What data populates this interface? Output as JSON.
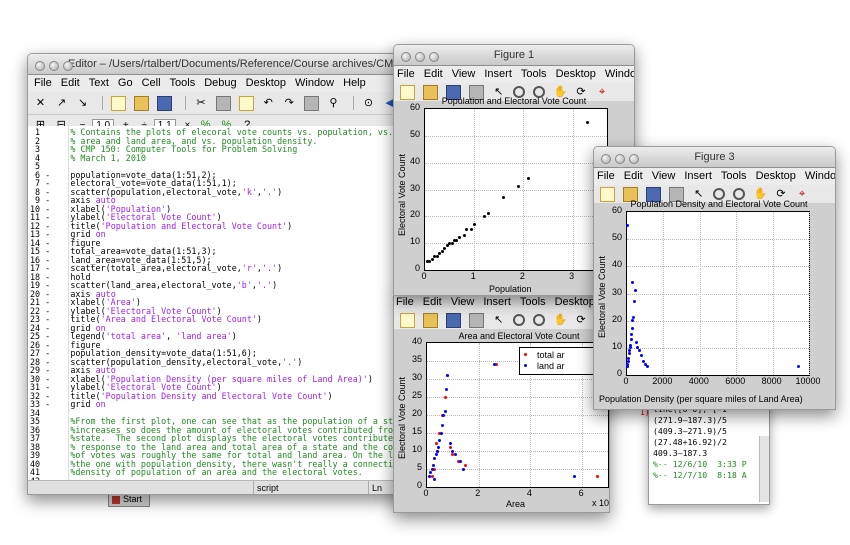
{
  "editor": {
    "title": "Editor – /Users/rtalbert/Documents/Reference/Course archives/CMP150/Feb",
    "menu": [
      "File",
      "Edit",
      "Text",
      "Go",
      "Cell",
      "Tools",
      "Debug",
      "Desktop",
      "Window",
      "Help"
    ],
    "cell_toolbar": {
      "minus": "−",
      "val1": "1.0",
      "plus": "+",
      "div": "÷",
      "val2": "1.1",
      "x": "×"
    },
    "lines": [
      {
        "n": "1",
        "d": "",
        "t": "% Contains the plots of elecoral vote counts vs. population, vs. total",
        "c": "c"
      },
      {
        "n": "2",
        "d": "",
        "t": "% area and land area, and vs. population density.",
        "c": "c"
      },
      {
        "n": "3",
        "d": "",
        "t": "% CMP 150: Computer Tools for Problem Solving",
        "c": "c"
      },
      {
        "n": "4",
        "d": "",
        "t": "% March 1, 2010",
        "c": "c"
      },
      {
        "n": "5",
        "d": "",
        "t": "",
        "c": ""
      },
      {
        "n": "6",
        "d": "-",
        "t": "population=vote_data(1:51,2);",
        "c": ""
      },
      {
        "n": "7",
        "d": "-",
        "t": "electoral_vote=vote_data(1:51,1);",
        "c": ""
      },
      {
        "n": "8",
        "d": "-",
        "t": "scatter(population,electoral_vote,'k','.')",
        "c": ""
      },
      {
        "n": "9",
        "d": "-",
        "t": "axis auto",
        "c": ""
      },
      {
        "n": "10",
        "d": "-",
        "t": "xlabel('Population')",
        "c": ""
      },
      {
        "n": "11",
        "d": "-",
        "t": "ylabel('Electoral Vote Count')",
        "c": ""
      },
      {
        "n": "12",
        "d": "-",
        "t": "title('Population and Electoral Vote Count')",
        "c": ""
      },
      {
        "n": "13",
        "d": "-",
        "t": "grid on",
        "c": ""
      },
      {
        "n": "14",
        "d": "-",
        "t": "figure",
        "c": ""
      },
      {
        "n": "15",
        "d": "-",
        "t": "total_area=vote_data(1:51,3);",
        "c": ""
      },
      {
        "n": "16",
        "d": "-",
        "t": "land_area=vote_data(1:51,5);",
        "c": ""
      },
      {
        "n": "17",
        "d": "-",
        "t": "scatter(total_area,electoral_vote,'r','.')",
        "c": ""
      },
      {
        "n": "18",
        "d": "-",
        "t": "hold",
        "c": ""
      },
      {
        "n": "19",
        "d": "-",
        "t": "scatter(land_area,electoral_vote,'b','.')",
        "c": ""
      },
      {
        "n": "20",
        "d": "-",
        "t": "axis auto",
        "c": ""
      },
      {
        "n": "21",
        "d": "-",
        "t": "xlabel('Area')",
        "c": ""
      },
      {
        "n": "22",
        "d": "-",
        "t": "ylabel('Electoral Vote Count')",
        "c": ""
      },
      {
        "n": "23",
        "d": "-",
        "t": "title('Area and Electoral Vote Count')",
        "c": ""
      },
      {
        "n": "24",
        "d": "-",
        "t": "grid on",
        "c": ""
      },
      {
        "n": "25",
        "d": "-",
        "t": "legend('total area', 'land area')",
        "c": ""
      },
      {
        "n": "26",
        "d": "-",
        "t": "figure",
        "c": ""
      },
      {
        "n": "27",
        "d": "-",
        "t": "population_density=vote_data(1:51,6);",
        "c": ""
      },
      {
        "n": "28",
        "d": "-",
        "t": "scatter(population_density,electoral_vote,'.')",
        "c": ""
      },
      {
        "n": "29",
        "d": "-",
        "t": "axis auto",
        "c": ""
      },
      {
        "n": "30",
        "d": "-",
        "t": "xlabel('Population Density (per square miles of Land Area)')",
        "c": ""
      },
      {
        "n": "31",
        "d": "-",
        "t": "ylabel('Electoral Vote Count')",
        "c": ""
      },
      {
        "n": "32",
        "d": "-",
        "t": "title('Population Density and Electoral Vote Count')",
        "c": ""
      },
      {
        "n": "33",
        "d": "-",
        "t": "grid on",
        "c": ""
      },
      {
        "n": "34",
        "d": "",
        "t": "",
        "c": ""
      },
      {
        "n": "35",
        "d": "",
        "t": "%From the first plot, one can see that as the population of a state",
        "c": "c"
      },
      {
        "n": "36",
        "d": "",
        "t": "%increases so does the amount of electoral votes contributed from that",
        "c": "c"
      },
      {
        "n": "37",
        "d": "",
        "t": "%state.  The second plot displays the electoral votes contributed in",
        "c": "c"
      },
      {
        "n": "38",
        "d": "",
        "t": "% response to the land area and total area of a state and the contributi",
        "c": "c"
      },
      {
        "n": "39",
        "d": "",
        "t": "%of votes was roughly the same for total and land area. On the last plot,",
        "c": "c"
      },
      {
        "n": "40",
        "d": "",
        "t": "%the one with population density, there wasn't really a connection to the",
        "c": "c"
      },
      {
        "n": "41",
        "d": "",
        "t": "%density of population of an area and the electoral votes.",
        "c": "c"
      },
      {
        "n": "42",
        "d": "",
        "t": "",
        "c": ""
      },
      {
        "n": "43",
        "d": "",
        "t": "",
        "c": ""
      }
    ],
    "status": {
      "mode": "script",
      "ln": "Ln",
      "col": "3"
    }
  },
  "start_button": "Start",
  "figure1": {
    "title": "Figure 1",
    "menu": [
      "File",
      "Edit",
      "View",
      "Insert",
      "Tools",
      "Desktop",
      "Window",
      "Help"
    ],
    "plot_title": "Population and Electoral Vote Count",
    "xlabel": "Population",
    "ylabel": "Electoral Vote Count",
    "yticks": [
      "0",
      "10",
      "20",
      "30",
      "40",
      "50",
      "60"
    ],
    "xticks": [
      "0",
      "1",
      "2",
      "3"
    ]
  },
  "figure2": {
    "menu": [
      "File",
      "Edit",
      "View",
      "Insert",
      "Tools",
      "Desktop",
      "Window"
    ],
    "plot_title": "Area and Electoral Vote Count",
    "xlabel": "Area",
    "ylabel": "Electoral Vote Count",
    "yticks": [
      "0",
      "5",
      "10",
      "15",
      "20",
      "25",
      "30",
      "35",
      "40"
    ],
    "xticks": [
      "0",
      "2",
      "4",
      "6"
    ],
    "xexp": "x 10",
    "xexp_sup": "6",
    "legend": [
      "total ar",
      "land ar"
    ]
  },
  "figure3": {
    "title": "Figure 3",
    "menu": [
      "File",
      "Edit",
      "View",
      "Insert",
      "Tools",
      "Desktop",
      "Window",
      "Help"
    ],
    "plot_title": "Population Density and Electoral Vote Count",
    "xlabel": "Population Density (per square miles of Land Area)",
    "ylabel": "Electoral Vote Count",
    "yticks": [
      "0",
      "10",
      "20",
      "30",
      "40",
      "50",
      "60"
    ],
    "xticks": [
      "0",
      "2000",
      "4000",
      "6000",
      "8000",
      "10000"
    ]
  },
  "history": {
    "lines": [
      "line([0 0], [-1",
      "(271.9–187.3)/5",
      "(409.3–271.9)/5",
      "(27.48+16.92)/2",
      "409.3–187.3",
      "%-- 12/6/10  3:33 P",
      "%-- 12/7/10  8:18 A"
    ],
    "label": "1)"
  },
  "colors": {
    "series_total": "#ff0000",
    "series_land": "#0000ff",
    "pop": "#000000",
    "comment": "#228b22",
    "string": "#a020f0"
  },
  "chart_data": [
    {
      "type": "scatter",
      "title": "Population and Electoral Vote Count",
      "xlabel": "Population",
      "ylabel": "Electoral Vote Count",
      "xlim": [
        0,
        3.7
      ],
      "ylim": [
        0,
        60
      ],
      "series": [
        {
          "values": [
            [
              0.05,
              3
            ],
            [
              0.1,
              3
            ],
            [
              0.15,
              4
            ],
            [
              0.2,
              5
            ],
            [
              0.25,
              5
            ],
            [
              0.3,
              6
            ],
            [
              0.35,
              7
            ],
            [
              0.4,
              8
            ],
            [
              0.45,
              9
            ],
            [
              0.5,
              10
            ],
            [
              0.55,
              10
            ],
            [
              0.6,
              11
            ],
            [
              0.65,
              11
            ],
            [
              0.7,
              12
            ],
            [
              0.8,
              13
            ],
            [
              0.85,
              15
            ],
            [
              0.95,
              15
            ],
            [
              1.0,
              17
            ],
            [
              1.2,
              20
            ],
            [
              1.3,
              21
            ],
            [
              1.6,
              27
            ],
            [
              1.9,
              31
            ],
            [
              2.1,
              34
            ],
            [
              3.3,
              55
            ]
          ]
        }
      ]
    },
    {
      "type": "scatter",
      "title": "Area and Electoral Vote Count",
      "xlabel": "Area",
      "ylabel": "Electoral Vote Count",
      "xlim": [
        0,
        7
      ],
      "ylim": [
        0,
        40
      ],
      "series": [
        {
          "name": "total ar",
          "values": [
            [
              0.2,
              3
            ],
            [
              0.3,
              5
            ],
            [
              0.4,
              10
            ],
            [
              0.5,
              15
            ],
            [
              0.6,
              20
            ],
            [
              0.7,
              25
            ],
            [
              0.8,
              31
            ],
            [
              0.9,
              11
            ],
            [
              1.0,
              9
            ],
            [
              1.2,
              7
            ],
            [
              2.7,
              34
            ],
            [
              6.6,
              3
            ],
            [
              1.5,
              6
            ],
            [
              0.35,
              12
            ]
          ]
        },
        {
          "name": "land ar",
          "values": [
            [
              0.1,
              3
            ],
            [
              0.15,
              4
            ],
            [
              0.2,
              5
            ],
            [
              0.25,
              6
            ],
            [
              0.3,
              8
            ],
            [
              0.35,
              9
            ],
            [
              0.4,
              10
            ],
            [
              0.45,
              11
            ],
            [
              0.5,
              13
            ],
            [
              0.55,
              15
            ],
            [
              0.6,
              17
            ],
            [
              0.65,
              20
            ],
            [
              0.7,
              21
            ],
            [
              0.75,
              27
            ],
            [
              0.8,
              31
            ],
            [
              0.5,
              55
            ],
            [
              0.9,
              12
            ],
            [
              1.0,
              10
            ],
            [
              1.1,
              9
            ],
            [
              1.3,
              7
            ],
            [
              2.6,
              34
            ],
            [
              5.7,
              3
            ],
            [
              1.4,
              5
            ],
            [
              0.3,
              2
            ]
          ]
        }
      ]
    },
    {
      "type": "scatter",
      "title": "Population Density and Electoral Vote Count",
      "xlabel": "Population Density (per square miles of Land Area)",
      "ylabel": "Electoral Vote Count",
      "xlim": [
        0,
        10000
      ],
      "ylim": [
        0,
        60
      ],
      "series": [
        {
          "values": [
            [
              20,
              3
            ],
            [
              50,
              4
            ],
            [
              80,
              5
            ],
            [
              100,
              6
            ],
            [
              120,
              8
            ],
            [
              150,
              9
            ],
            [
              180,
              10
            ],
            [
              200,
              11
            ],
            [
              220,
              13
            ],
            [
              250,
              15
            ],
            [
              280,
              17
            ],
            [
              300,
              20
            ],
            [
              350,
              21
            ],
            [
              400,
              27
            ],
            [
              450,
              31
            ],
            [
              500,
              12
            ],
            [
              600,
              10
            ],
            [
              700,
              9
            ],
            [
              800,
              7
            ],
            [
              900,
              5
            ],
            [
              1000,
              4
            ],
            [
              1100,
              3
            ],
            [
              50,
              55
            ],
            [
              10,
              3
            ],
            [
              9400,
              3
            ],
            [
              300,
              34
            ]
          ]
        }
      ]
    }
  ]
}
